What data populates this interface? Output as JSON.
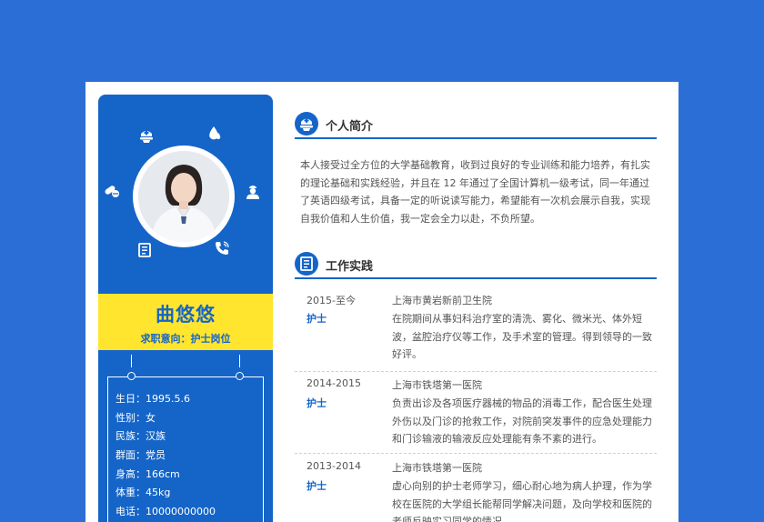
{
  "sidebar": {
    "name": "曲悠悠",
    "intent": "求职意向：护士岗位",
    "info": [
      "生日：1995.5.6",
      "性别：女",
      "民族：汉族",
      "群面：党员",
      "身高：166cm",
      "体重：45kg",
      "电话：10000000000"
    ],
    "icons": [
      "nurse-cap-icon",
      "drop-icon",
      "pills-icon",
      "nurse-icon",
      "document-icon",
      "phone-icon"
    ]
  },
  "profile": {
    "title": "个人简介",
    "text": "本人接受过全方位的大学基础教育，收到过良好的专业训练和能力培养，有扎实的理论基础和实践经验，并且在 12 年通过了全国计算机一级考试，同一年通过了英语四级考试，具备一定的听说读写能力，希望能有一次机会展示自我，实现自我价值和人生价值，我一定会全力以赴，不负所望。"
  },
  "work": {
    "title": "工作实践",
    "jobs": [
      {
        "year": "2015-至今",
        "role": "护士",
        "company": "上海市黄岩新前卫生院",
        "desc": "在院期间从事妇科治疗室的清洗、雾化、微米光、体外短波，盆腔治疗仪等工作，及手术室的管理。得到领导的一致好评。"
      },
      {
        "year": "2014-2015",
        "role": "护士",
        "company": "上海市铁塔第一医院",
        "desc": "负责出诊及各项医疗器械的物品的消毒工作，配合医生处理外伤以及门诊的抢救工作，对院前突发事件的应急处理能力和门诊输液的输液反应处理能有条不紊的进行。"
      },
      {
        "year": "2013-2014",
        "role": "护士",
        "company": "上海市铁塔第一医院",
        "desc": "虚心向别的护士老师学习，细心耐心地为病人护理，作为学校在医院的大学组长能帮同学解决问题，及向学校和医院的老师反映实习同学的情况。"
      }
    ]
  },
  "colors": {
    "primary": "#1565c8",
    "accent": "#ffe52e",
    "background": "#2b6fd6"
  }
}
